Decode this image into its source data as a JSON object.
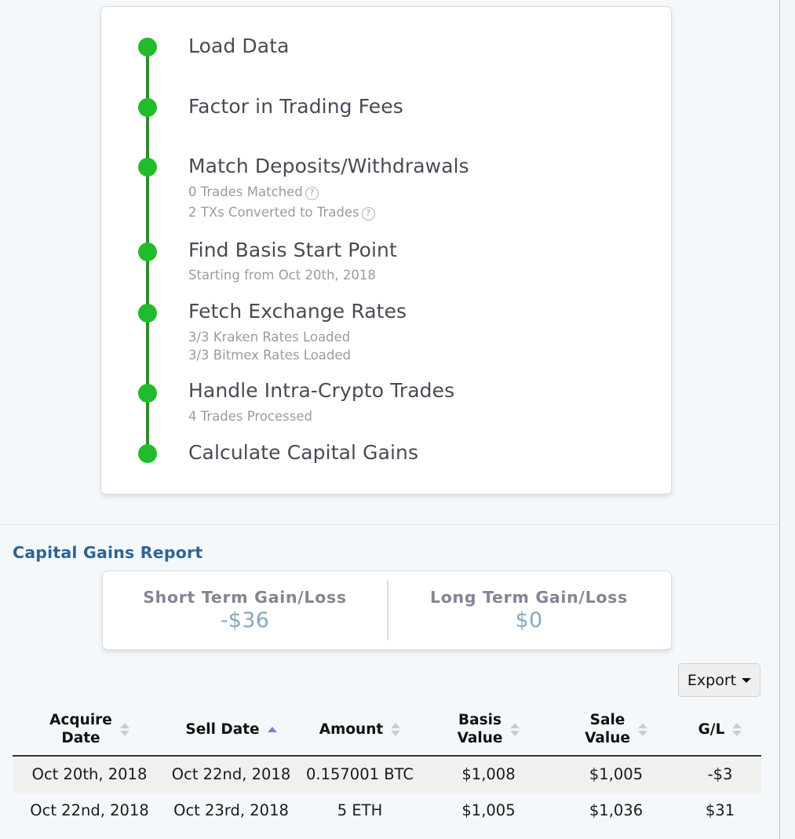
{
  "progress": {
    "steps": [
      {
        "title": "Load Data",
        "details": []
      },
      {
        "title": "Factor in Trading Fees",
        "details": []
      },
      {
        "title": "Match Deposits/Withdrawals",
        "details": [
          {
            "text": "0 Trades Matched",
            "help": true
          },
          {
            "text": "2 TXs Converted to Trades",
            "help": true
          }
        ]
      },
      {
        "title": "Find Basis Start Point",
        "details": [
          {
            "text": "Starting from Oct 20th, 2018",
            "help": false
          }
        ]
      },
      {
        "title": "Fetch Exchange Rates",
        "details": [
          {
            "text": "3/3 Kraken Rates Loaded",
            "help": false
          },
          {
            "text": "3/3 Bitmex Rates Loaded",
            "help": false
          }
        ]
      },
      {
        "title": "Handle Intra-Crypto Trades",
        "details": [
          {
            "text": "4 Trades Processed",
            "help": false
          }
        ]
      },
      {
        "title": "Calculate Capital Gains",
        "details": []
      }
    ],
    "dot_color": "#22bb2b",
    "rail_color": "#2e8b2e",
    "help_glyph": "?"
  },
  "report": {
    "title": "Capital Gains Report",
    "title_color": "#2e6496",
    "summary": [
      {
        "label": "Short Term Gain/Loss",
        "value": "-$36"
      },
      {
        "label": "Long Term Gain/Loss",
        "value": "$0"
      }
    ],
    "export_label": "Export",
    "table": {
      "columns": [
        {
          "label": "Acquire\nDate",
          "sort": "none"
        },
        {
          "label": "Sell Date",
          "sort": "asc"
        },
        {
          "label": "Amount",
          "sort": "none"
        },
        {
          "label": "Basis\nValue",
          "sort": "none"
        },
        {
          "label": "Sale\nValue",
          "sort": "none"
        },
        {
          "label": "G/L",
          "sort": "none"
        }
      ],
      "column_labels": {
        "acquire_line1": "Acquire",
        "acquire_line2": "Date",
        "sell": "Sell Date",
        "amount": "Amount",
        "basis_line1": "Basis",
        "basis_line2": "Value",
        "sale_line1": "Sale",
        "sale_line2": "Value",
        "gl": "G/L"
      },
      "rows": [
        {
          "acquire_date": "Oct 20th, 2018",
          "sell_date": "Oct 22nd, 2018",
          "amount": "0.157001 BTC",
          "basis_value": "$1,008",
          "sale_value": "$1,005",
          "gain_loss": "-$3",
          "gain_loss_sign": "negative"
        },
        {
          "acquire_date": "Oct 22nd, 2018",
          "sell_date": "Oct 23rd, 2018",
          "amount": "5 ETH",
          "basis_value": "$1,005",
          "sale_value": "$1,036",
          "gain_loss": "$31",
          "gain_loss_sign": "positive"
        }
      ]
    }
  }
}
